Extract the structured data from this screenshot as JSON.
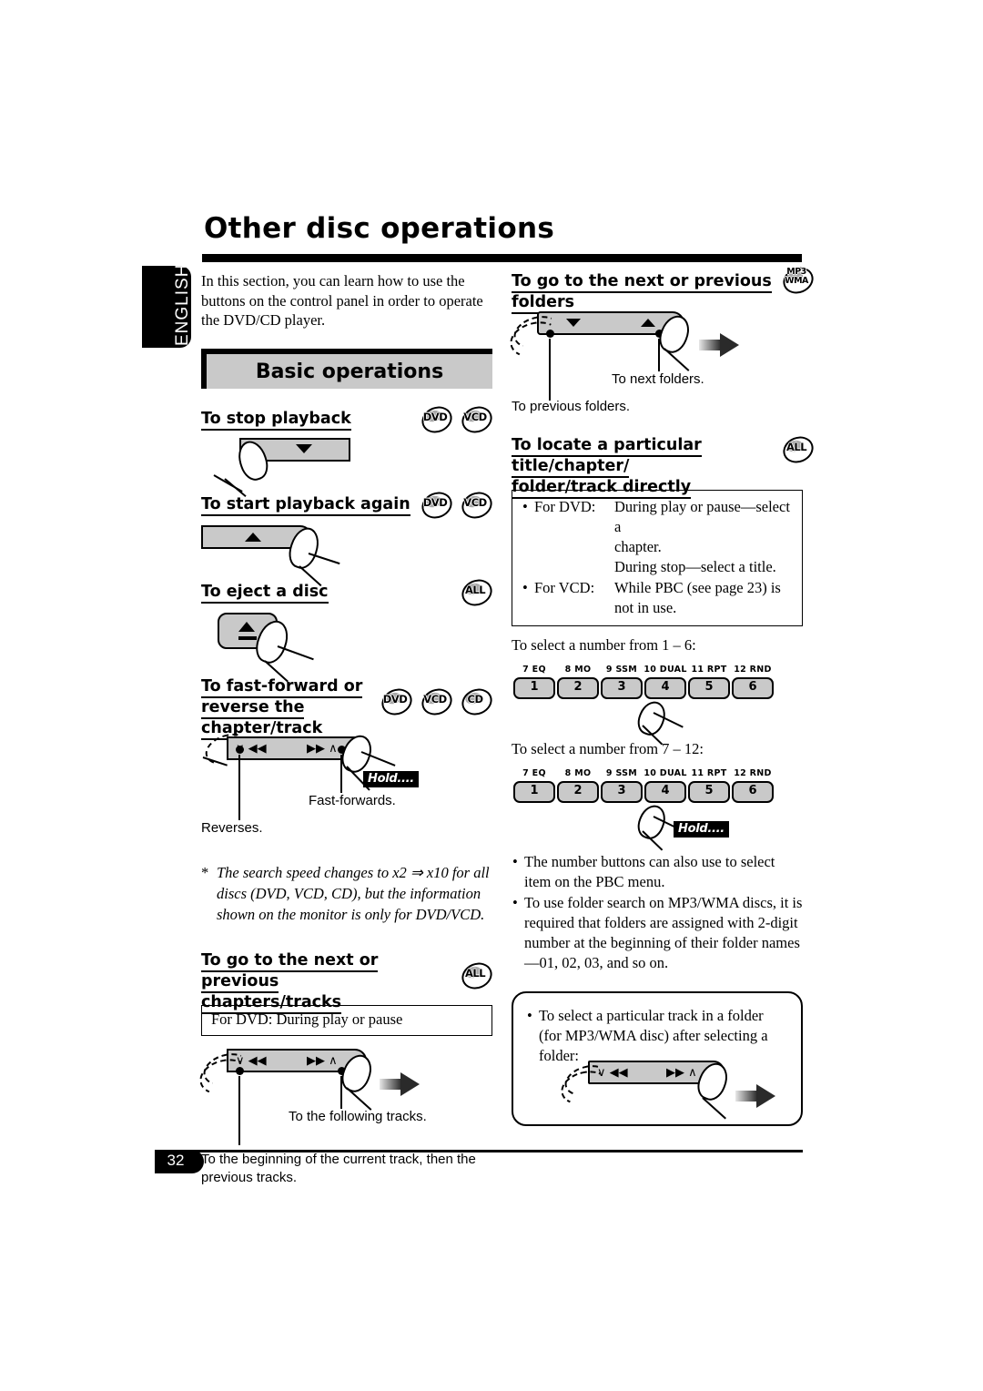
{
  "document": {
    "title": "Other disc operations",
    "language_tab": "ENGLISH",
    "page_number": "32"
  },
  "left_column": {
    "intro": "In this section, you can learn how to use the buttons on the control panel in order to operate the DVD/CD player.",
    "banner": "Basic operations",
    "sections": {
      "stop": {
        "heading": "To stop playback",
        "badges": [
          "DVD",
          "VCD"
        ]
      },
      "start": {
        "heading": "To start playback again",
        "badges": [
          "DVD",
          "VCD"
        ]
      },
      "eject": {
        "heading": "To eject a disc",
        "badges": [
          "ALL"
        ]
      },
      "fast_forward": {
        "heading_line1": "To fast-forward or",
        "heading_line2": "reverse the chapter/track",
        "badges": [
          "DVD",
          "VCD",
          "CD"
        ],
        "hold_tag": "Hold....",
        "caption_forward": "Fast-forwards.",
        "caption_reverse": "Reverses.",
        "footnote": "The search speed changes to x2 ⇒ x10 for all discs (DVD, VCD, CD), but the information shown on the monitor is only for DVD/VCD."
      },
      "next_prev_chapters": {
        "heading_line1": "To go to the next or previous",
        "heading_line2": "chapters/tracks",
        "badges": [
          "ALL"
        ],
        "box_text": "For DVD: During play or pause",
        "caption_following": "To the following tracks.",
        "caption_beginning": "To the beginning of the current track, then the previous tracks."
      }
    }
  },
  "right_column": {
    "sections": {
      "next_prev_folders": {
        "heading": "To go to the next or previous folders",
        "badges": [
          "MP3/WMA"
        ],
        "caption_next": "To next folders.",
        "caption_previous": "To previous folders."
      },
      "locate_directly": {
        "heading_line1": "To locate a particular title/chapter/",
        "heading_line2": "folder/track directly",
        "badges": [
          "ALL"
        ],
        "box_bullets": [
          {
            "key": "For DVD:",
            "lines": [
              "During play or pause—select a",
              "chapter.",
              "During stop—select a title."
            ]
          },
          {
            "key": "For VCD:",
            "lines": [
              "While PBC (see page 23) is",
              "not in use."
            ]
          }
        ],
        "select_1_6": "To select a number from 1 – 6:",
        "select_7_12": "To select a number from 7 – 12:",
        "hold_tag": "Hold....",
        "numpad_labels": [
          "7 EQ",
          "8 MO",
          "9 SSM",
          "10 DUAL",
          "11 RPT",
          "12 RND"
        ],
        "numpad_numbers": [
          "1",
          "2",
          "3",
          "4",
          "5",
          "6"
        ],
        "bullets": [
          "The number buttons can also use to select item on the PBC menu.",
          "To use folder search on MP3/WMA discs, it is required that folders are assigned with 2-digit number at the beginning of their folder names—01, 02, 03, and so on."
        ],
        "round_box_bullet": "To select a particular track in a folder (for MP3/WMA disc) after selecting a folder:"
      }
    }
  },
  "glyphs": {
    "prev_bar": "∨ ◀◀",
    "next_bar": "▶▶ ∧",
    "eject": "▲"
  },
  "colors": {
    "panel_gray": "#c9c9c9",
    "black": "#000000",
    "badge_shade": "#a8a8a8"
  }
}
